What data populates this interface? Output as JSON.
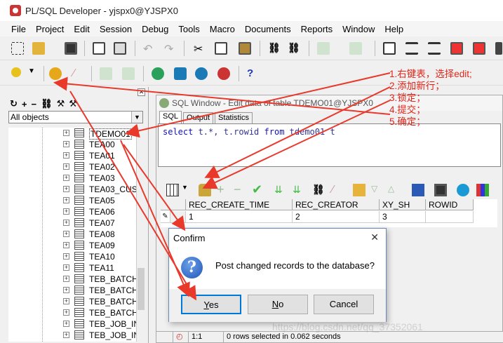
{
  "window": {
    "title": "PL/SQL Developer - yjspx0@YJSPX0"
  },
  "menu": [
    "File",
    "Project",
    "Edit",
    "Session",
    "Debug",
    "Tools",
    "Macro",
    "Documents",
    "Reports",
    "Window",
    "Help"
  ],
  "object_browser": {
    "filter": "All objects",
    "items": [
      "TDEMO01",
      "TEA00",
      "TEA01",
      "TEA02",
      "TEA03",
      "TEA03_CUS",
      "TEA05",
      "TEA06",
      "TEA07",
      "TEA08",
      "TEA09",
      "TEA10",
      "TEA11",
      "TEB_BATCH",
      "TEB_BATCH",
      "TEB_BATCH",
      "TEB_BATCH",
      "TEB_JOB_IN",
      "TEB_JOB_IN"
    ],
    "selected_index": 0
  },
  "sql_window": {
    "title": "SQL Window - Edit data of table TDEMO01@YJSPX0",
    "tabs": [
      "SQL",
      "Output",
      "Statistics"
    ],
    "active_tab": 0,
    "sql": {
      "kw1": "select",
      "mid": " t.*, t.rowid ",
      "kw2": "from",
      "tail": " tdemo01 t"
    },
    "grid": {
      "columns": [
        "REC_CREATE_TIME",
        "REC_CREATOR",
        "XY_SH",
        "ROWID"
      ],
      "row": [
        "1",
        "2",
        "3",
        ""
      ]
    },
    "status": {
      "pos": "1:1",
      "message": "0 rows selected in 0.062 seconds"
    }
  },
  "dialog": {
    "title": "Confirm",
    "close": "✕",
    "message": "Post changed records to the database?",
    "icon": "?",
    "buttons": [
      {
        "label": "Yes",
        "accel": "Y",
        "rest": "es"
      },
      {
        "label": "No",
        "accel": "N",
        "rest": "o"
      },
      {
        "label": "Cancel"
      }
    ]
  },
  "annotation": [
    "1.右键表，选择edit;",
    "2.添加新行；",
    "3.锁定；",
    "4.提交；",
    "5.确定；"
  ],
  "watermark": "https://blog.csdn.net/qq_37352061",
  "colors": {
    "arrow": "#e8392b",
    "accent": "#0078d7"
  }
}
